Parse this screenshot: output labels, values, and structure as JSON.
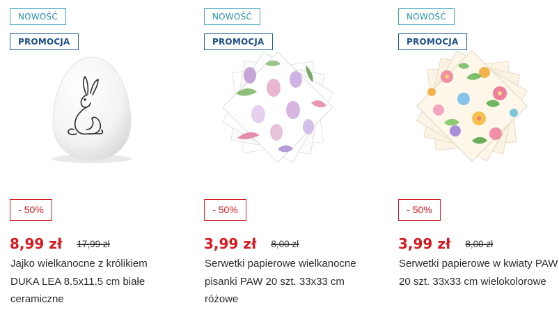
{
  "products": [
    {
      "badge_new": "NOWOŚĆ",
      "badge_promo": "PROMOCJA",
      "image": "ceramic-egg-rabbit",
      "discount": "- 50%",
      "price": "8,99 zł",
      "old_price": "17,99 zł",
      "title": "Jajko wielkanocne z królikiem DUKA LEA 8.5x11.5 cm białe ceramiczne"
    },
    {
      "badge_new": "NOWOŚĆ",
      "badge_promo": "PROMOCJA",
      "image": "easter-napkins-eggs",
      "discount": "- 50%",
      "price": "3,99 zł",
      "old_price": "8,00 zł",
      "title": "Serwetki papierowe wielkanocne pisanki PAW 20 szt. 33x33 cm różowe"
    },
    {
      "badge_new": "NOWOŚĆ",
      "badge_promo": "PROMOCJA",
      "image": "floral-napkins",
      "discount": "- 50%",
      "price": "3,99 zł",
      "old_price": "8,00 zł",
      "title": "Serwetki papierowe w kwiaty PAW 20 szt. 33x33 cm wielokolorowe"
    }
  ],
  "colors": {
    "sale_red": "#d4191f",
    "new_badge": "#3fa3c0",
    "promo_badge": "#1f5f9e"
  }
}
